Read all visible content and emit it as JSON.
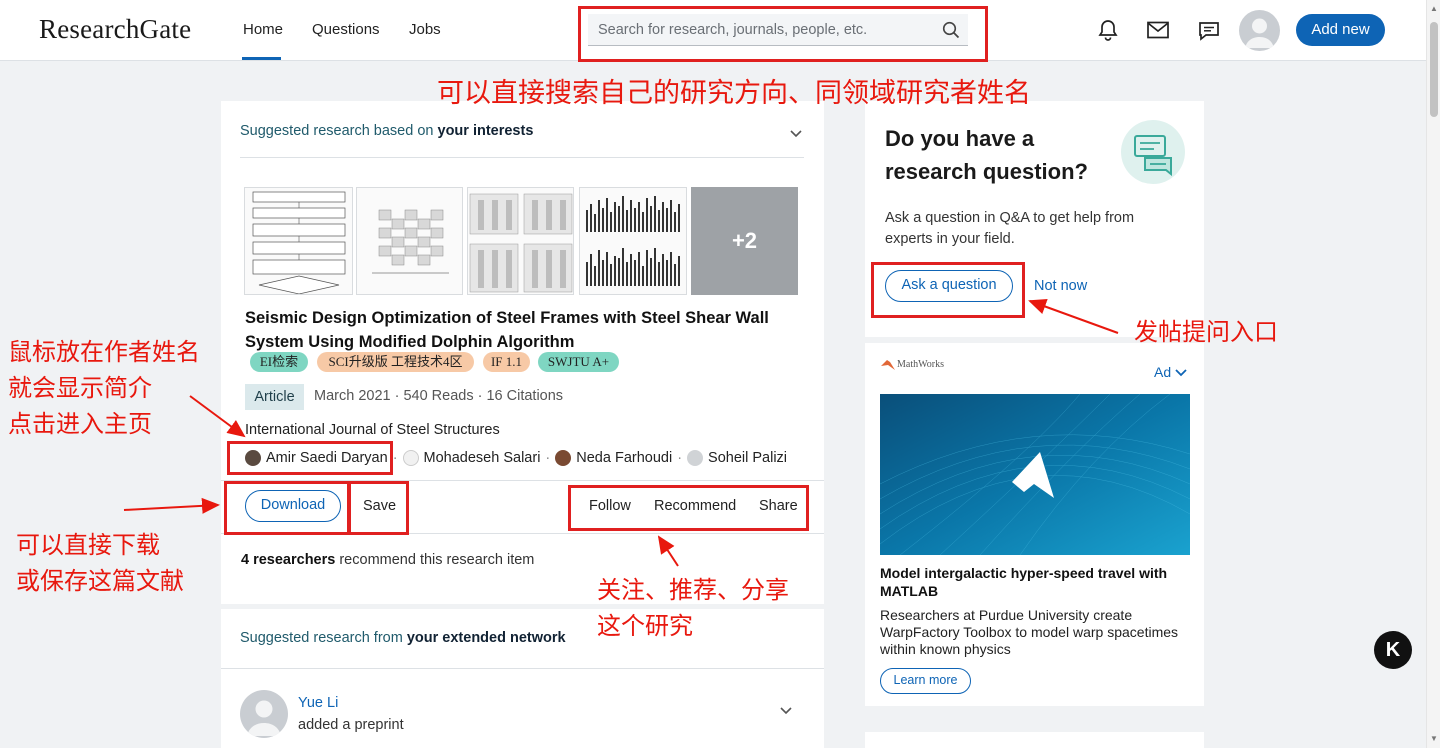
{
  "header": {
    "logo": "ResearchGate",
    "nav": [
      "Home",
      "Questions",
      "Jobs"
    ],
    "search_placeholder": "Search for research, journals, people, etc.",
    "add_new": "Add new",
    "accent_color": "#0e64b5"
  },
  "feed": {
    "suggested": {
      "prefix": "Suggested research based on ",
      "emphasis": "your interests",
      "thumbnail_more": "+2",
      "title": "Seismic Design Optimization of Steel Frames with Steel Shear Wall System Using Modified Dolphin Algorithm",
      "tags": [
        {
          "label": "EI检索",
          "color": "#7fd6c2"
        },
        {
          "label": "SCI升级版 工程技术4区",
          "color": "#f7c9a6"
        },
        {
          "label": "IF 1.1",
          "color": "#f7c9a6"
        },
        {
          "label": "SWJTU A+",
          "color": "#7fd6c2"
        }
      ],
      "type": "Article",
      "meta": "March 2021 · 540 Reads · 16 Citations",
      "journal": "International Journal of Steel Structures",
      "authors": [
        "Amir Saedi Daryan",
        "Mohadeseh Salari",
        "Neda Farhoudi",
        "Soheil Palizi"
      ],
      "actions": {
        "download": "Download",
        "save": "Save",
        "follow": "Follow",
        "recommend": "Recommend",
        "share": "Share"
      },
      "recommend_count": "4 researchers",
      "recommend_suffix": " recommend this research item"
    },
    "network": {
      "prefix": "Suggested research from ",
      "emphasis": "your extended network",
      "person": "Yue Li",
      "action": "added a preprint"
    }
  },
  "sidebar": {
    "question": {
      "title": "Do you have a research question?",
      "text": "Ask a question in Q&A to get help from experts in your field.",
      "ask": "Ask a question",
      "not_now": "Not now"
    },
    "ad": {
      "brand": "MathWorks",
      "label": "Ad",
      "title": "Model intergalactic hyper-speed travel with MATLAB",
      "body": "Researchers at Purdue University create WarpFactory Toolbox to model warp spacetimes within known physics",
      "cta": "Learn more"
    }
  },
  "annotations": {
    "search": "可以直接搜索自己的研究方向、同领域研究者姓名",
    "hover_line1": "鼠标放在作者姓名",
    "hover_line2": "就会显示简介",
    "hover_line3": "点击进入主页",
    "download_line1": "可以直接下载",
    "download_line2": "或保存这篇文献",
    "actions_line1": "关注、推荐、分享",
    "actions_line2": "这个研究",
    "ask": "发帖提问入口",
    "color": "#e8180e"
  }
}
